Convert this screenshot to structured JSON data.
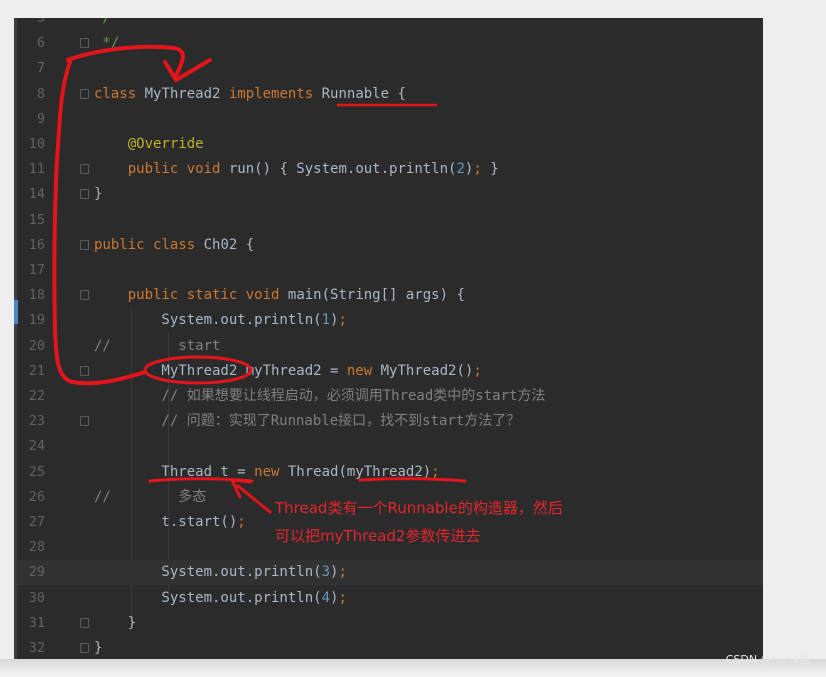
{
  "editor": {
    "lines": [
      {
        "n": "5",
        "code": "*/"
      },
      {
        "n": "6",
        "code": " */"
      },
      {
        "n": "7",
        "code": ""
      },
      {
        "n": "8",
        "code": "class MyThread2 implements Runnable {"
      },
      {
        "n": "9",
        "code": ""
      },
      {
        "n": "10",
        "code": "    @Override"
      },
      {
        "n": "11",
        "code": "    public void run() { System.out.println(2); }"
      },
      {
        "n": "14",
        "code": "}"
      },
      {
        "n": "15",
        "code": ""
      },
      {
        "n": "16",
        "code": "public class Ch02 {"
      },
      {
        "n": "17",
        "code": ""
      },
      {
        "n": "18",
        "code": "    public static void main(String[] args) {"
      },
      {
        "n": "19",
        "code": "        System.out.println(1);"
      },
      {
        "n": "20",
        "code": "//        start"
      },
      {
        "n": "21",
        "code": "        MyThread2 myThread2 = new MyThread2();"
      },
      {
        "n": "22",
        "code": "        // 如果想要让线程启动，必须调用Thread类中的start方法"
      },
      {
        "n": "23",
        "code": "        // 问题：实现了Runnable接口，找不到start方法了？"
      },
      {
        "n": "24",
        "code": ""
      },
      {
        "n": "25",
        "code": "        Thread t = new Thread(myThread2);"
      },
      {
        "n": "26",
        "code": "//        多态"
      },
      {
        "n": "27",
        "code": "        t.start();"
      },
      {
        "n": "28",
        "code": ""
      },
      {
        "n": "29",
        "code": "        System.out.println(3);"
      },
      {
        "n": "30",
        "code": "        System.out.println(4);"
      },
      {
        "n": "31",
        "code": "    }"
      },
      {
        "n": "32",
        "code": "}"
      }
    ]
  },
  "annotation": {
    "line1": "Thread类有一个Runnable的构造器，然后",
    "line2": "可以把myThread2参数传进去"
  },
  "watermark": "CSDN @haha姐",
  "colors": {
    "background": "#2b2b2b",
    "keyword": "#cc7832",
    "annotation_ink": "#e5262d",
    "current_line": "#323232"
  }
}
